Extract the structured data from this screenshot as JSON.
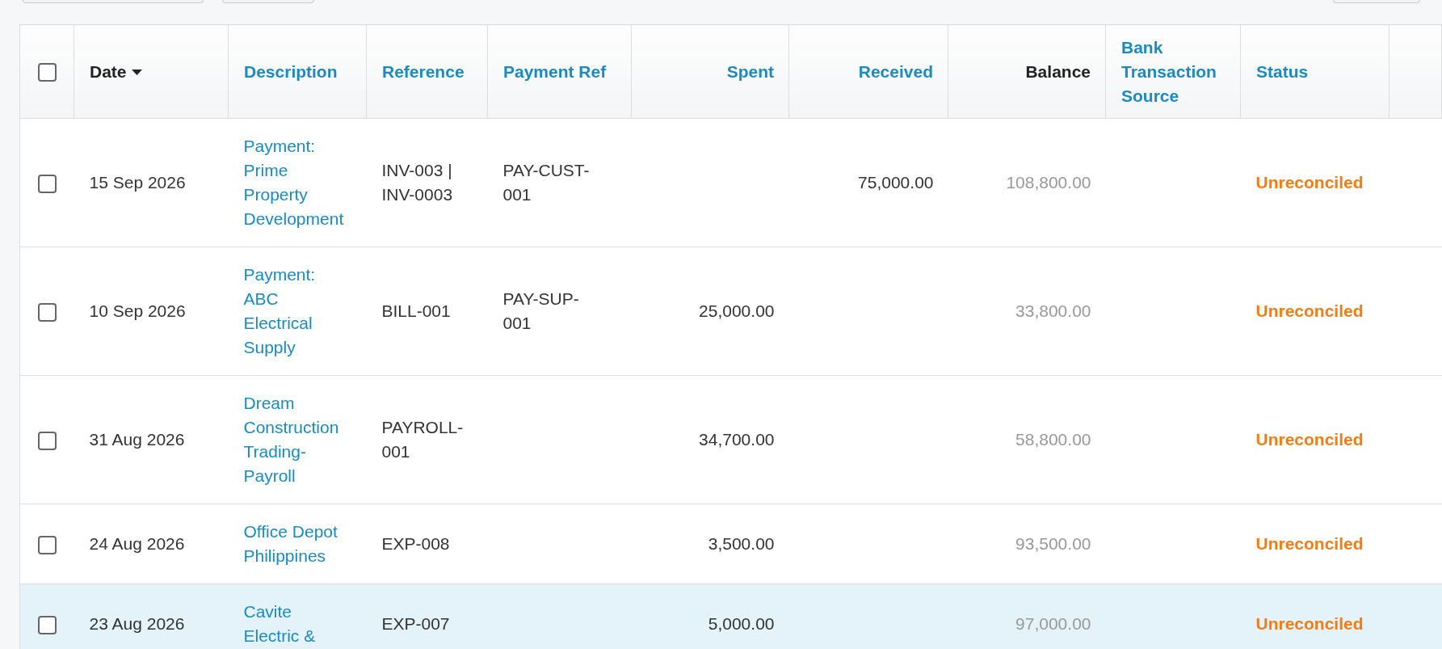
{
  "columns": [
    {
      "kind": "checkbox",
      "checked": false
    },
    {
      "label": "Date",
      "kind": "sorted",
      "numeric": false
    },
    {
      "label": "Description",
      "kind": "link",
      "numeric": false
    },
    {
      "label": "Reference",
      "kind": "link",
      "numeric": false
    },
    {
      "label": "Payment Ref",
      "kind": "link",
      "numeric": false
    },
    {
      "label": "Spent",
      "kind": "link",
      "numeric": true
    },
    {
      "label": "Received",
      "kind": "link",
      "numeric": true
    },
    {
      "label": "Balance",
      "kind": "plain",
      "numeric": true
    },
    {
      "label": "Bank Transaction Source",
      "kind": "link",
      "numeric": false
    },
    {
      "label": "Status",
      "kind": "link",
      "numeric": false
    }
  ],
  "rows": [
    {
      "checked": false,
      "highlighted": false,
      "date": "15 Sep 2026",
      "description": "Payment: Prime Property Development",
      "reference": "INV-003 | INV-0003",
      "payment_ref": "PAY-CUST-001",
      "received": "75,000.00",
      "balance": "108,800.00",
      "status": "Unreconciled"
    },
    {
      "checked": false,
      "highlighted": false,
      "date": "10 Sep 2026",
      "description": "Payment: ABC Electrical Supply",
      "reference": "BILL-001",
      "payment_ref": "PAY-SUP-001",
      "spent": "25,000.00",
      "balance": "33,800.00",
      "status": "Unreconciled"
    },
    {
      "checked": false,
      "highlighted": false,
      "date": "31 Aug 2026",
      "description": "Dream Construction Trading-Payroll",
      "reference": "PAYROLL-001",
      "spent": "34,700.00",
      "balance": "58,800.00",
      "status": "Unreconciled"
    },
    {
      "checked": false,
      "highlighted": false,
      "date": "24 Aug 2026",
      "description": "Office Depot Philippines",
      "reference": "EXP-008",
      "spent": "3,500.00",
      "balance": "93,500.00",
      "status": "Unreconciled"
    },
    {
      "checked": false,
      "highlighted": true,
      "date": "23 Aug 2026",
      "description": "Cavite Electric &",
      "reference": "EXP-007",
      "spent": "5,000.00",
      "balance": "97,000.00",
      "status": "Unreconciled"
    }
  ]
}
